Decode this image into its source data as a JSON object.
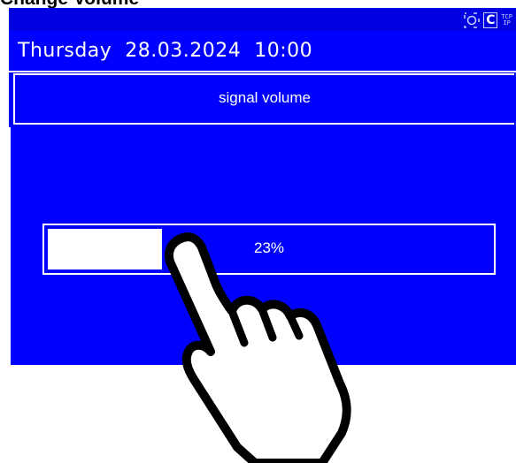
{
  "caption": "Change Volume",
  "status_bar": {
    "icons": [
      "camera-icon",
      "c-logo-icon",
      "tcp-ip-icon"
    ],
    "c_glyph": "C",
    "tcp_line1": "TCP",
    "tcp_line2": "IP"
  },
  "header": {
    "datetime": "Thursday  28.03.2024  10:00"
  },
  "panel": {
    "title": "signal volume"
  },
  "volume": {
    "value_fraction": 0.23,
    "label": "23%"
  },
  "colors": {
    "screen_background": "#0000ff",
    "foreground": "#ffffff",
    "page_background": "#ffffff"
  },
  "hand_icon": "pointing-hand-icon"
}
